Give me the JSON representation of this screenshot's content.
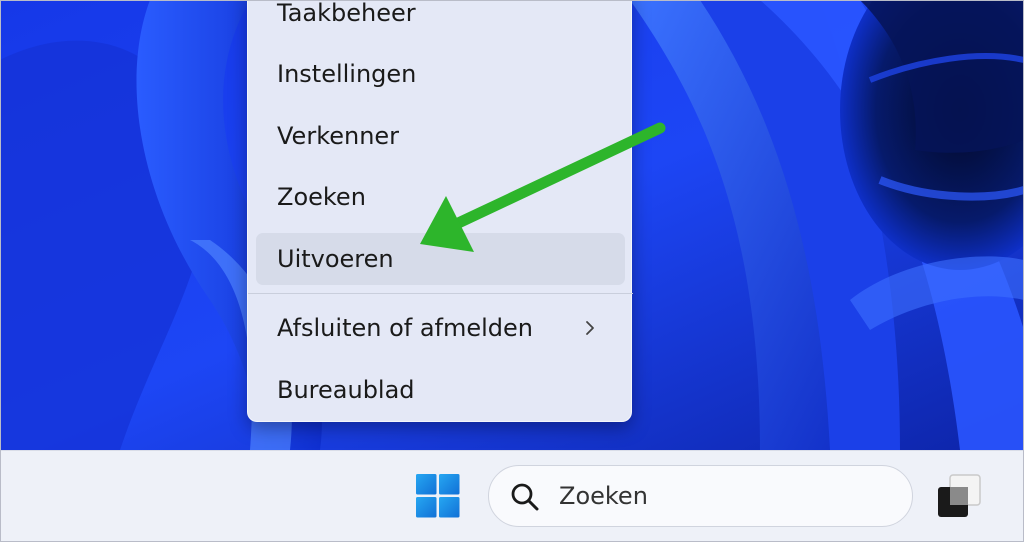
{
  "context_menu": {
    "items": [
      {
        "label": "Taakbeheer"
      },
      {
        "label": "Instellingen"
      },
      {
        "label": "Verkenner"
      },
      {
        "label": "Zoeken"
      },
      {
        "label": "Uitvoeren",
        "highlighted": true
      },
      {
        "label": "Afsluiten of afmelden",
        "has_submenu": true
      },
      {
        "label": "Bureaublad"
      }
    ]
  },
  "annotation": {
    "arrow_color": "#2db52b",
    "points_to": "Uitvoeren"
  },
  "taskbar": {
    "start_icon": "windows-logo-icon",
    "search": {
      "placeholder": "Zoeken",
      "icon": "search-icon"
    },
    "task_view_icon": "task-view-icon"
  },
  "colors": {
    "wallpaper_blue": "#1a3df0",
    "menu_background": "#e4e8f6",
    "taskbar_background": "#eef1f8",
    "windows_logo": "#1a8ee0"
  }
}
